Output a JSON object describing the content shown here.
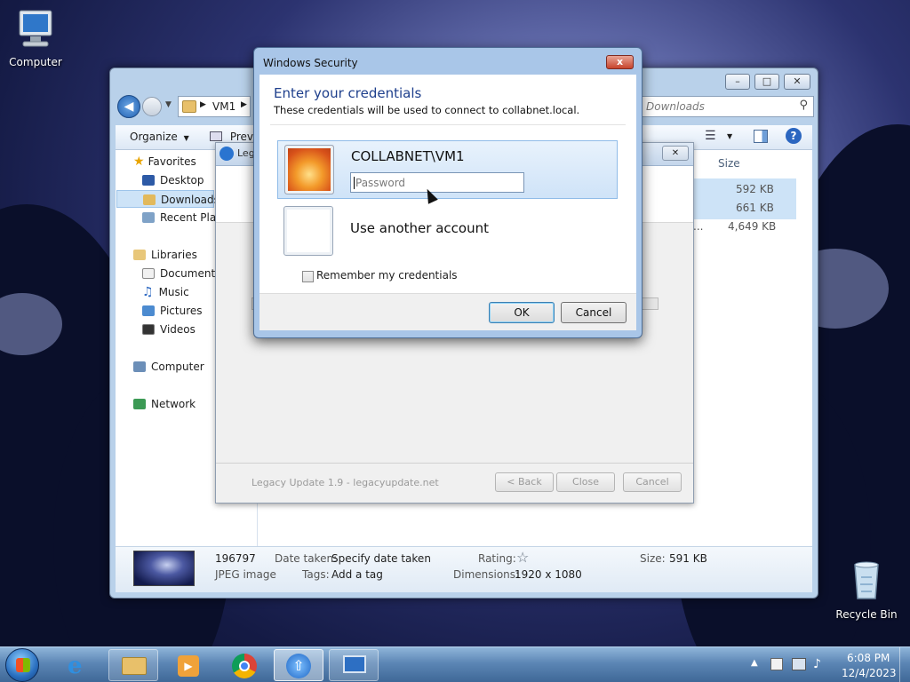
{
  "desktop": {
    "icons": [
      {
        "label": "Computer"
      },
      {
        "label": "Recycle Bin"
      }
    ]
  },
  "explorer": {
    "breadcrumb": [
      "VM1"
    ],
    "search_placeholder": "Downloads",
    "toolbar": {
      "organize": "Organize",
      "preview": "Previ"
    },
    "column_size": "Size",
    "sizes": [
      "592 KB",
      "661 KB",
      "4,649 KB"
    ],
    "truncated_name": "...",
    "nav": {
      "favorites": "Favorites",
      "desktop": "Desktop",
      "downloads": "Downloads",
      "recent": "Recent Plac",
      "libraries": "Libraries",
      "documents": "Documents",
      "music": "Music",
      "pictures": "Pictures",
      "videos": "Videos",
      "computer": "Computer",
      "network": "Network"
    },
    "details": {
      "name": "196797",
      "type": "JPEG image",
      "date_label": "Date taken:",
      "date_value": "Specify date taken",
      "tags_label": "Tags:",
      "tags_value": "Add a tag",
      "rating_label": "Rating:",
      "rating_stars": 0,
      "dimensions_label": "Dimensions:",
      "dimensions_value": "1920 x 1080",
      "size_label": "Size:",
      "size_value": "591 KB"
    }
  },
  "wizard": {
    "tab_label": "Leg",
    "footer_text": "Legacy Update 1.9 - legacyupdate.net",
    "back": "< Back",
    "close": "Close",
    "cancel": "Cancel"
  },
  "security_dialog": {
    "title": "Windows Security",
    "heading": "Enter your credentials",
    "subtext": "These credentials will be used to connect to collabnet.local.",
    "account_name": "COLLABNET\\VM1",
    "password_placeholder": "Password",
    "other_account": "Use another account",
    "remember_label": "Remember my credentials",
    "remember_checked": false,
    "ok": "OK",
    "cancel": "Cancel",
    "close_glyph": "x"
  },
  "taskbar": {
    "time": "6:08 PM",
    "date": "12/4/2023"
  },
  "colors": {
    "heading_blue": "#1e3f8c",
    "taskbar": "#5c86b5",
    "selection": "#cde3f7"
  }
}
